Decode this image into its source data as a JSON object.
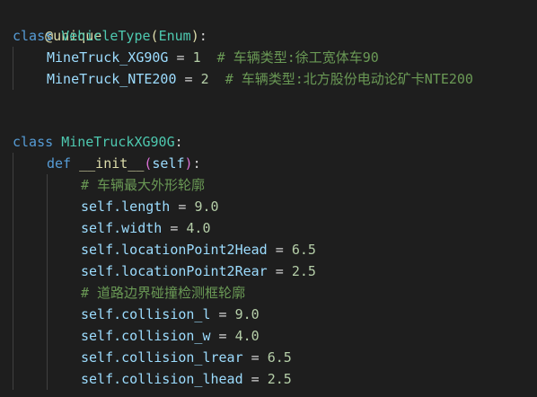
{
  "code": {
    "line1": {
      "decorator": "@unique"
    },
    "line2": {
      "kw": "class",
      "name": "VehicleType",
      "open": "(",
      "base": "Enum",
      "close": ")",
      "colon": ":"
    },
    "line3": {
      "name": "MineTruck_XG90G",
      "eq": " = ",
      "value": "1",
      "comment": "# 车辆类型:徐工宽体车90"
    },
    "line4": {
      "name": "MineTruck_NTE200",
      "eq": " = ",
      "value": "2",
      "comment": "# 车辆类型:北方股份电动论矿卡NTE200"
    },
    "line7": {
      "kw": "class",
      "name": "MineTruckXG90G",
      "colon": ":"
    },
    "line8": {
      "kw": "def",
      "name": "__init__",
      "open": "(",
      "param": "self",
      "close": ")",
      "colon": ":"
    },
    "line9": {
      "comment": "# 车辆最大外形轮廓"
    },
    "line10": {
      "self": "self",
      "attr": ".length",
      "eq": " = ",
      "value": "9.0"
    },
    "line11": {
      "self": "self",
      "attr": ".width",
      "eq": " = ",
      "value": "4.0"
    },
    "line12": {
      "self": "self",
      "attr": ".locationPoint2Head",
      "eq": " = ",
      "value": "6.5"
    },
    "line13": {
      "self": "self",
      "attr": ".locationPoint2Rear",
      "eq": " = ",
      "value": "2.5"
    },
    "line14": {
      "comment": "# 道路边界碰撞检测框轮廓"
    },
    "line15": {
      "self": "self",
      "attr": ".collision_l",
      "eq": " = ",
      "value": "9.0"
    },
    "line16": {
      "self": "self",
      "attr": ".collision_w",
      "eq": " = ",
      "value": "4.0"
    },
    "line17": {
      "self": "self",
      "attr": ".collision_lrear",
      "eq": " = ",
      "value": "6.5"
    },
    "line18": {
      "self": "self",
      "attr": ".collision_lhead",
      "eq": " = ",
      "value": "2.5"
    }
  }
}
